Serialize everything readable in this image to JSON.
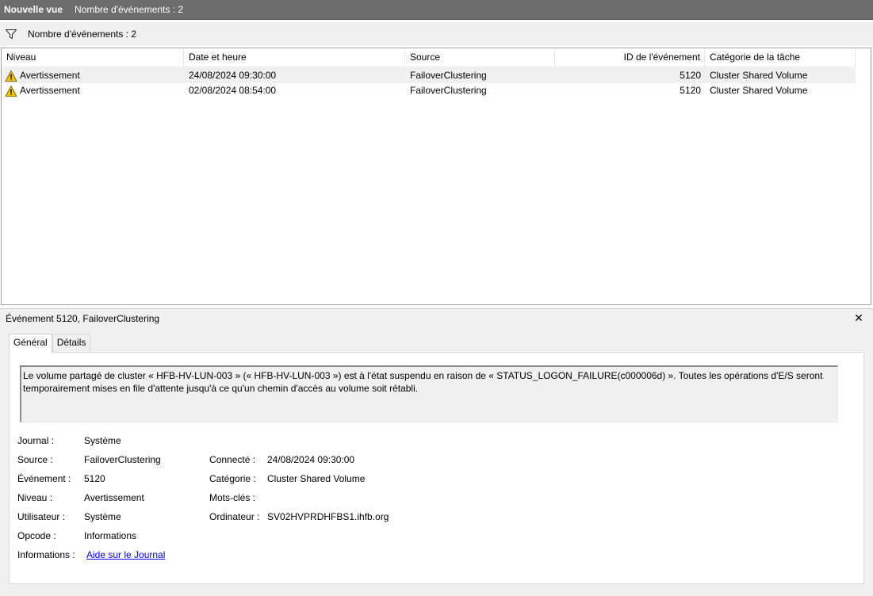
{
  "titlebar": {
    "name": "Nouvelle vue",
    "count_text": "Nombre d'événements : 2"
  },
  "filterbar": {
    "icon": "filter-icon",
    "count_text": "Nombre d'événements : 2"
  },
  "list": {
    "columns": [
      "Niveau",
      "Date et heure",
      "Source",
      "ID de l'événement",
      "Catégorie de la tâche"
    ],
    "rows": [
      {
        "level": "Avertissement",
        "datetime": "24/08/2024 09:30:00",
        "source": "FailoverClustering",
        "event_id": "5120",
        "category": "Cluster Shared Volume",
        "selected": true
      },
      {
        "level": "Avertissement",
        "datetime": "02/08/2024 08:54:00",
        "source": "FailoverClustering",
        "event_id": "5120",
        "category": "Cluster Shared Volume",
        "selected": false
      }
    ]
  },
  "detail": {
    "title": "Événement 5120, FailoverClustering",
    "close_glyph": "✕",
    "tabs": [
      "Général",
      "Détails"
    ],
    "description": "Le volume partagé de cluster « HFB-HV-LUN-003 » (« HFB-HV-LUN-003 ») est à l'état suspendu en raison de « STATUS_LOGON_FAILURE(c000006d) ». Toutes les opérations d'E/S seront temporairement mises en file d'attente jusqu'à ce qu'un chemin d'accès au volume soit rétabli.",
    "props": {
      "journal_label": "Journal :",
      "journal_value": "Système",
      "source_label": "Source :",
      "source_value": "FailoverClustering",
      "event_label": "Événement :",
      "event_value": "5120",
      "level_label": "Niveau :",
      "level_value": "Avertissement",
      "user_label": "Utilisateur :",
      "user_value": "Système",
      "opcode_label": "Opcode :",
      "opcode_value": "Informations",
      "info_label": "Informations :",
      "info_link": "Aide sur le Journal",
      "logged_label": "Connecté :",
      "logged_value": "24/08/2024 09:30:00",
      "category_label": "Catégorie :",
      "category_value": "Cluster Shared Volume",
      "keywords_label": "Mots-clés :",
      "keywords_value": "",
      "computer_label": "Ordinateur :",
      "computer_value": "SV02HVPRDHFBS1.ihfb.org"
    }
  },
  "colors": {
    "titlebar_bg": "#6d6d6d",
    "selected_row": "#f0f0f0",
    "warning": "#f5c400",
    "link": "#0000ee"
  }
}
